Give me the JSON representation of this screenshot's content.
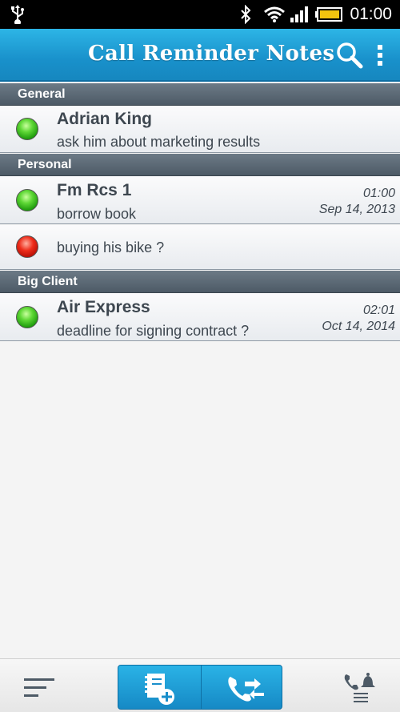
{
  "status_bar": {
    "time": "01:00",
    "icons": [
      "usb-icon",
      "bluetooth-icon",
      "wifi-icon",
      "signal-icon",
      "battery-icon"
    ]
  },
  "app_bar": {
    "title": "Call Reminder Notes",
    "icons": [
      "search-icon",
      "overflow-menu-icon"
    ],
    "color": "#1991cb"
  },
  "sections": [
    {
      "title": "General",
      "items": [
        {
          "name": "Adrian King",
          "note": "ask him about marketing results",
          "status": "green",
          "time": "",
          "date": ""
        }
      ]
    },
    {
      "title": "Personal",
      "items": [
        {
          "name": "Fm Rcs 1",
          "note": "borrow book",
          "status": "green",
          "time": "01:00",
          "date": "Sep 14, 2013"
        },
        {
          "name": "",
          "note": "buying his bike ?",
          "status": "red",
          "time": "",
          "date": ""
        }
      ]
    },
    {
      "title": "Big Client",
      "items": [
        {
          "name": "Air Express",
          "note": "deadline for signing contract ?",
          "status": "green",
          "time": "02:01",
          "date": "Oct 14, 2014"
        }
      ]
    }
  ],
  "bottom_bar": {
    "icons": [
      "sort-menu-icon",
      "add-note-icon",
      "call-transfer-icon",
      "call-alert-icon"
    ]
  },
  "colors": {
    "status_green": "#1d9a0c",
    "status_red": "#b30d05",
    "section_header": "#5a6772"
  }
}
